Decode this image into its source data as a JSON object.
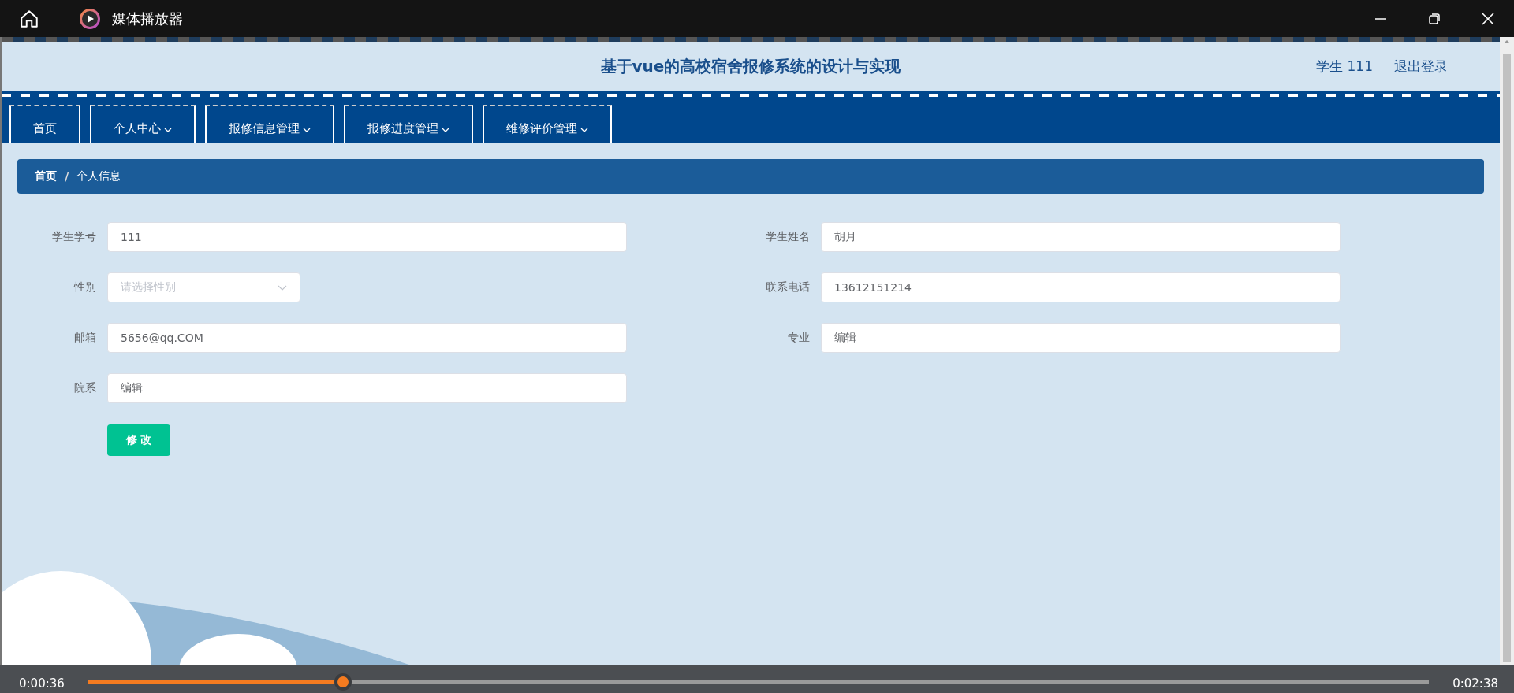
{
  "window": {
    "title": "媒体播放器"
  },
  "header": {
    "title": "基于vue的高校宿舍报修系统的设计与实现",
    "user": "学生 111",
    "logout": "退出登录"
  },
  "nav": [
    {
      "label": "首页",
      "dropdown": false
    },
    {
      "label": "个人中心",
      "dropdown": true
    },
    {
      "label": "报修信息管理",
      "dropdown": true
    },
    {
      "label": "报修进度管理",
      "dropdown": true
    },
    {
      "label": "维修评价管理",
      "dropdown": true
    }
  ],
  "breadcrumb": {
    "items": [
      "首页",
      "个人信息"
    ],
    "separator": "/"
  },
  "form": {
    "fields": [
      {
        "label": "学生学号",
        "kind": "text",
        "value": "111"
      },
      {
        "label": "学生姓名",
        "kind": "text",
        "value": "胡月"
      },
      {
        "label": "性别",
        "kind": "select",
        "placeholder": "请选择性别"
      },
      {
        "label": "联系电话",
        "kind": "text",
        "value": "13612151214"
      },
      {
        "label": "邮箱",
        "kind": "text",
        "value": "5656@qq.COM"
      },
      {
        "label": "专业",
        "kind": "text",
        "value": "编辑"
      },
      {
        "label": "院系",
        "kind": "text",
        "value": "编辑"
      }
    ],
    "submit": "修 改"
  },
  "player": {
    "elapsed": "0:00:36",
    "total": "0:02:38",
    "level": 0.19
  }
}
